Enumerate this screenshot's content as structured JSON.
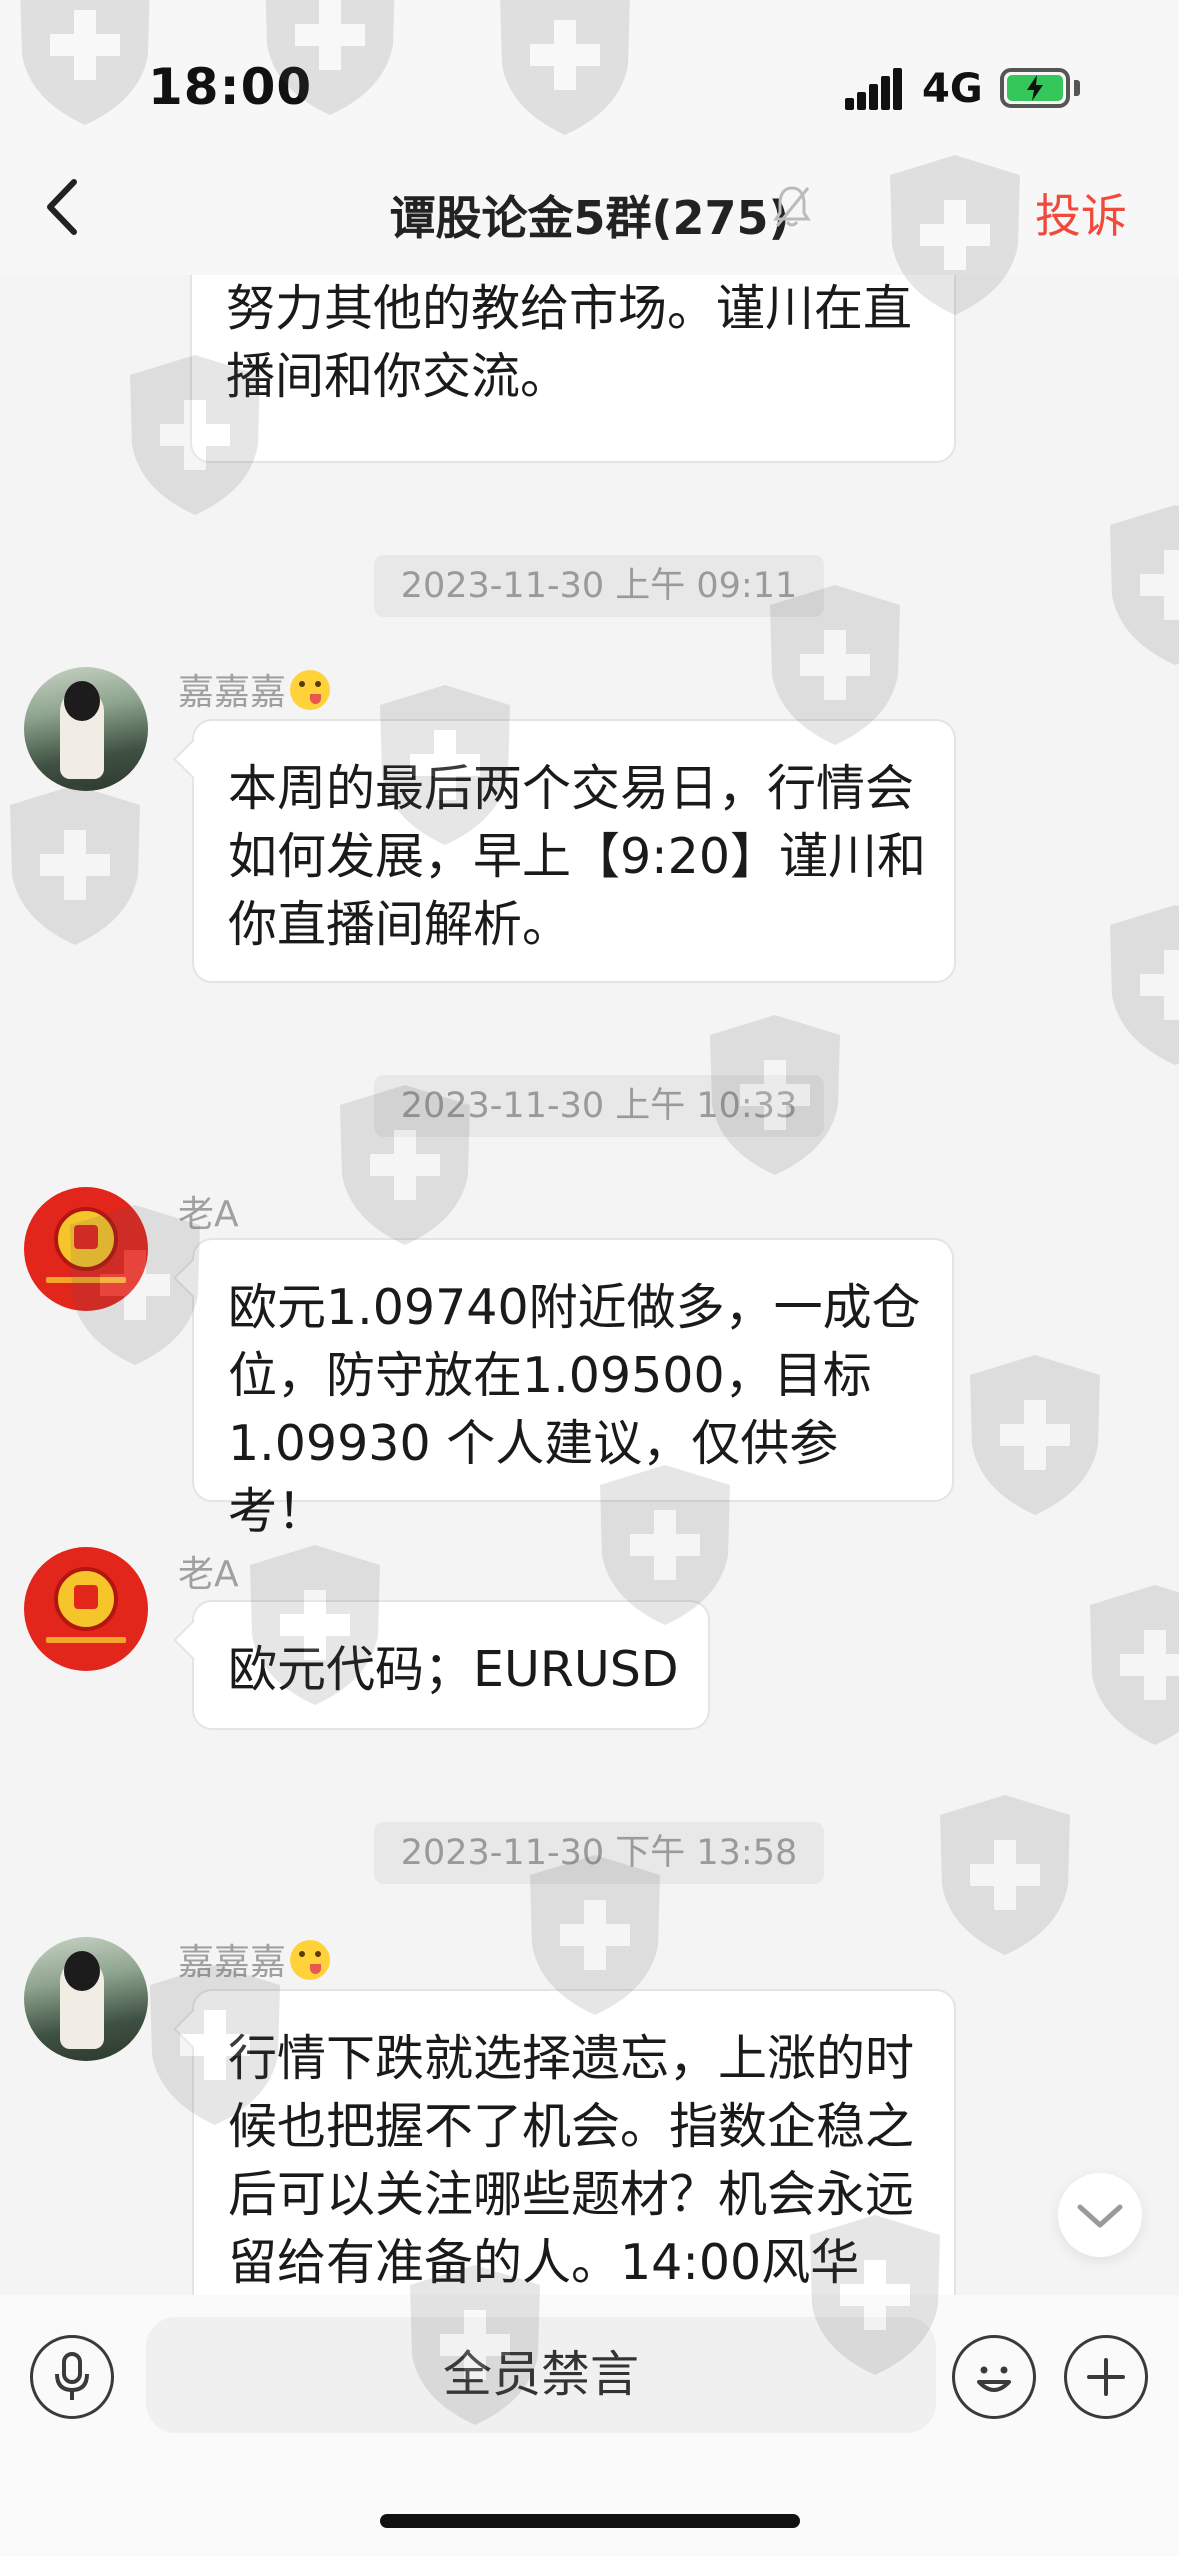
{
  "status_bar": {
    "time": "18:00",
    "network": "4G"
  },
  "nav": {
    "title": "谭股论金5群(275)",
    "complaint": "投诉"
  },
  "messages": {
    "m0": {
      "text": "个敢总你还是干去成功，你只管努力其他的教给市场。谨川在直播间和你交流。",
      "line1": "努力其他的教给市场。谨川在直",
      "line2": "播间和你交流。"
    },
    "ts1": "2023-11-30 上午 09:11",
    "m1": {
      "sender": "嘉嘉嘉",
      "line1": "本周的最后两个交易日，行情会",
      "line2": "如何发展，早上【9:20】谨川和",
      "line3": "你直播间解析。"
    },
    "ts2": "2023-11-30 上午 10:33",
    "m2": {
      "sender": "老A",
      "line1": "欧元1.09740附近做多，一成仓",
      "line2": "位，防守放在1.09500，目标",
      "line3": "1.09930 个人建议，仅供参考！"
    },
    "m3": {
      "sender": "老A",
      "line1": "欧元代码；EURUSD"
    },
    "ts3": "2023-11-30 下午 13:58",
    "m4": {
      "sender": "嘉嘉嘉",
      "line1": "行情下跌就选择遗忘，上涨的时",
      "line2": "候也把握不了机会。指数企稳之",
      "line3": "后可以关注哪些题材？机会永远",
      "line4": "留给有准备的人。14:00风华"
    }
  },
  "input_bar": {
    "muted_text": "全员禁言"
  },
  "icons": {
    "back": "chevron-left-icon",
    "bell": "bell-muted-icon",
    "mic": "microphone-icon",
    "emoji": "smiley-icon",
    "plus": "plus-icon",
    "scroll": "chevron-down-icon",
    "watermark": "shield-cross-icon"
  },
  "colors": {
    "accent_red": "#f04a3d",
    "battery_green": "#35c759",
    "bubble_bg": "#ffffff",
    "page_bg": "#f4f4f4"
  }
}
